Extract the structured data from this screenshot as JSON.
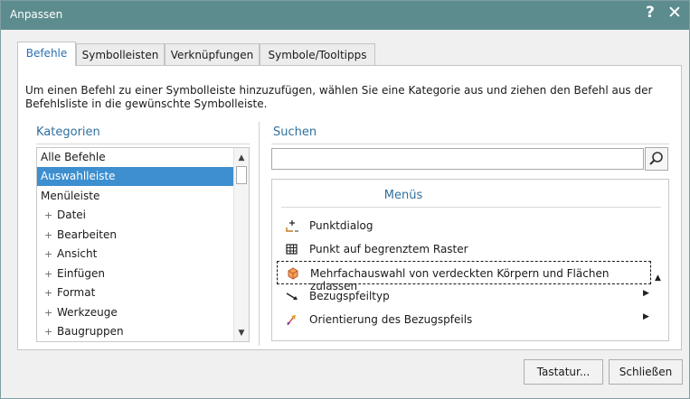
{
  "window": {
    "title": "Anpassen",
    "help_label": "?",
    "close_label": "✕"
  },
  "tabs": [
    {
      "label": "Befehle",
      "active": true
    },
    {
      "label": "Symbolleisten",
      "active": false
    },
    {
      "label": "Verknüpfungen",
      "active": false
    },
    {
      "label": "Symbole/Tooltipps",
      "active": false
    }
  ],
  "instruction": "Um einen Befehl zu einer Symbolleiste hinzuzufügen, wählen Sie eine Kategorie aus und ziehen den Befehl aus der Befehlsliste in die gewünschte Symbolleiste.",
  "categories": {
    "header": "Kategorien",
    "items": [
      {
        "label": "Alle Befehle",
        "expandable": false,
        "selected": false
      },
      {
        "label": "Auswahlleiste",
        "expandable": false,
        "selected": true
      },
      {
        "label": "Menüleiste",
        "expandable": false,
        "selected": false
      },
      {
        "label": "Datei",
        "expandable": true,
        "selected": false
      },
      {
        "label": "Bearbeiten",
        "expandable": true,
        "selected": false
      },
      {
        "label": "Ansicht",
        "expandable": true,
        "selected": false
      },
      {
        "label": "Einfügen",
        "expandable": true,
        "selected": false
      },
      {
        "label": "Format",
        "expandable": true,
        "selected": false
      },
      {
        "label": "Werkzeuge",
        "expandable": true,
        "selected": false
      },
      {
        "label": "Baugruppen",
        "expandable": true,
        "selected": false
      }
    ],
    "expand_glyph": "+"
  },
  "search": {
    "header": "Suchen",
    "value": "",
    "placeholder": "",
    "button_icon": "magnifier-icon"
  },
  "menus": {
    "title": "Menüs",
    "commands": [
      {
        "label": "Punktdialog",
        "icon": "point-dialog-icon",
        "has_submenu": false,
        "focused": false
      },
      {
        "label": "Punkt auf begrenztem Raster",
        "icon": "grid-point-icon",
        "has_submenu": false,
        "focused": false
      },
      {
        "label": "Mehrfachauswahl von verdeckten Körpern und Flächen zulassen",
        "icon": "multi-select-body-icon",
        "has_submenu": false,
        "focused": true
      },
      {
        "label": "Bezugspfeiltyp",
        "icon": "reference-arrow-icon",
        "has_submenu": true,
        "focused": false
      },
      {
        "label": "Orientierung des Bezugspfeils",
        "icon": "arrow-orientation-icon",
        "has_submenu": true,
        "focused": false
      }
    ],
    "submenu_glyph": "▶"
  },
  "buttons": {
    "keyboard": "Tastatur...",
    "close": "Schließen"
  },
  "colors": {
    "titlebar": "#5d8c8e",
    "accent": "#2f6f9f",
    "selection": "#3d8fd0"
  }
}
